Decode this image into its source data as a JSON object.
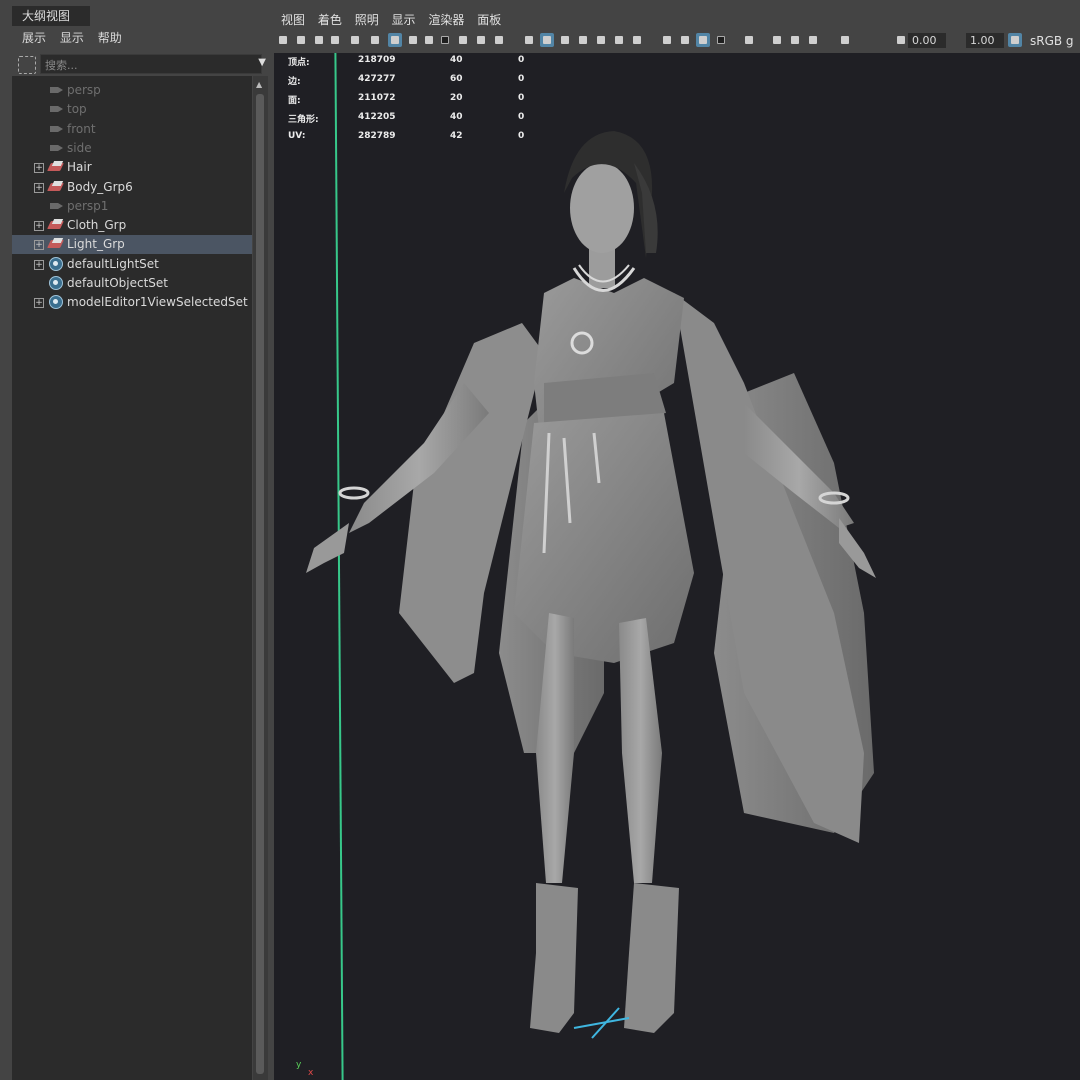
{
  "outliner": {
    "tab_title": "大纲视图",
    "menu": [
      "展示",
      "显示",
      "帮助"
    ],
    "search_placeholder": "搜索...",
    "items": [
      {
        "label": "persp",
        "type": "camera",
        "dim": true
      },
      {
        "label": "top",
        "type": "camera",
        "dim": true
      },
      {
        "label": "front",
        "type": "camera",
        "dim": true
      },
      {
        "label": "side",
        "type": "camera",
        "dim": true
      },
      {
        "label": "Hair",
        "type": "group",
        "expandable": true
      },
      {
        "label": "Body_Grp6",
        "type": "group",
        "expandable": true
      },
      {
        "label": "persp1",
        "type": "camera",
        "dim": true
      },
      {
        "label": "Cloth_Grp",
        "type": "group",
        "expandable": true
      },
      {
        "label": "Light_Grp",
        "type": "group",
        "expandable": true,
        "selected": true
      },
      {
        "label": "defaultLightSet",
        "type": "set",
        "expandable": true
      },
      {
        "label": "defaultObjectSet",
        "type": "set"
      },
      {
        "label": "modelEditor1ViewSelectedSet",
        "type": "set",
        "expandable": true
      }
    ]
  },
  "viewport": {
    "menu": [
      "视图",
      "着色",
      "照明",
      "显示",
      "渲染器",
      "面板"
    ],
    "exposure": "0.00",
    "gamma": "1.00",
    "color_space": "sRGB g",
    "hud": [
      {
        "label": "顶点:",
        "v1": "218709",
        "v2": "40",
        "v3": "0"
      },
      {
        "label": "边:",
        "v1": "427277",
        "v2": "60",
        "v3": "0"
      },
      {
        "label": "面:",
        "v1": "211072",
        "v2": "20",
        "v3": "0"
      },
      {
        "label": "三角形:",
        "v1": "412205",
        "v2": "40",
        "v3": "0"
      },
      {
        "label": "UV:",
        "v1": "282789",
        "v2": "42",
        "v3": "0"
      }
    ],
    "axis": {
      "y": "y",
      "x": "x"
    },
    "colors": {
      "selection": "#4b5563",
      "toggle_on": "#5285a6",
      "grid_axis": "#37c88a",
      "background": "#1f1f24"
    }
  }
}
